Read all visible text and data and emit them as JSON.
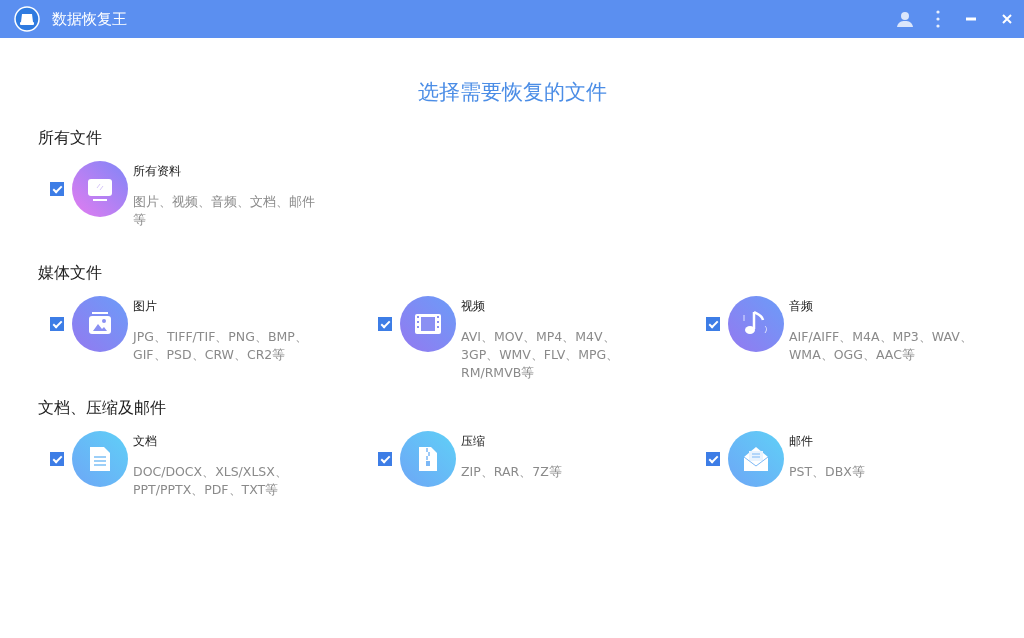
{
  "window": {
    "title": "数据恢复王"
  },
  "heading": "选择需要恢复的文件",
  "sections": [
    {
      "title": "所有文件",
      "items": [
        {
          "title": "所有资料",
          "description": "图片、视频、音频、文档、邮件等",
          "checked": true
        }
      ]
    },
    {
      "title": "媒体文件",
      "items": [
        {
          "title": "图片",
          "description": "JPG、TIFF/TIF、PNG、BMP、GIF、PSD、CRW、CR2等",
          "checked": true
        },
        {
          "title": "视频",
          "description": "AVI、MOV、MP4、M4V、3GP、WMV、FLV、MPG、RM/RMVB等",
          "checked": true
        },
        {
          "title": "音频",
          "description": "AIF/AIFF、M4A、MP3、WAV、WMA、OGG、AAC等",
          "checked": true
        }
      ]
    },
    {
      "title": "文档、压缩及邮件",
      "items": [
        {
          "title": "文档",
          "description": "DOC/DOCX、XLS/XLSX、PPT/PPTX、PDF、TXT等",
          "checked": true
        },
        {
          "title": "压缩",
          "description": "ZIP、RAR、7Z等",
          "checked": true
        },
        {
          "title": "邮件",
          "description": "PST、DBX等",
          "checked": true
        }
      ]
    }
  ]
}
